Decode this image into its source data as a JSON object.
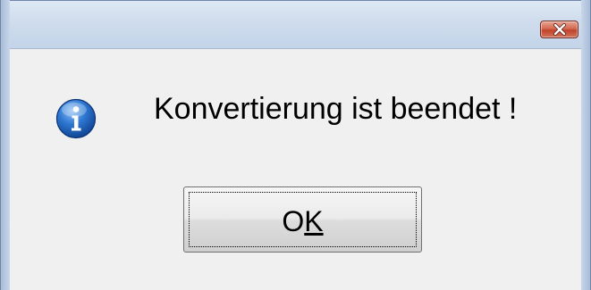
{
  "window": {
    "title": "",
    "close_icon": "close-icon"
  },
  "dialog": {
    "icon": "info-icon",
    "message": "Konvertierung ist beendet !",
    "ok_button": {
      "label_prefix": "O",
      "label_mnemonic": "K"
    }
  },
  "colors": {
    "close_button": "#c7452c",
    "info_icon": "#1f5fb5",
    "titlebar": "#cfdcec",
    "client_background": "#f0f0f0"
  }
}
